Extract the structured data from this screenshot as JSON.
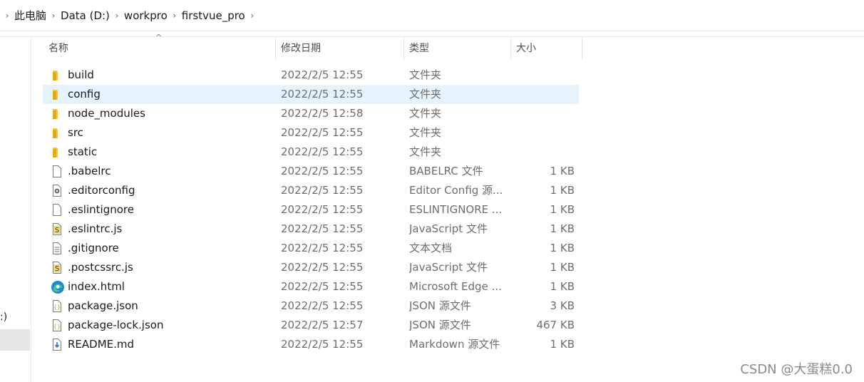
{
  "breadcrumb": {
    "items": [
      "此电脑",
      "Data (D:)",
      "workpro",
      "firstvue_pro"
    ],
    "separator": "›"
  },
  "nav": {
    "fragment": ":)"
  },
  "columns": {
    "name": "名称",
    "date": "修改日期",
    "type": "类型",
    "size": "大小",
    "sort_indicator": "^"
  },
  "rows": [
    {
      "name": "build",
      "date": "2022/2/5 12:55",
      "type": "文件夹",
      "size": "",
      "icon": "folder-icon"
    },
    {
      "name": "config",
      "date": "2022/2/5 12:55",
      "type": "文件夹",
      "size": "",
      "icon": "folder-icon",
      "selected": true
    },
    {
      "name": "node_modules",
      "date": "2022/2/5 12:58",
      "type": "文件夹",
      "size": "",
      "icon": "folder-icon"
    },
    {
      "name": "src",
      "date": "2022/2/5 12:55",
      "type": "文件夹",
      "size": "",
      "icon": "folder-icon"
    },
    {
      "name": "static",
      "date": "2022/2/5 12:55",
      "type": "文件夹",
      "size": "",
      "icon": "folder-icon"
    },
    {
      "name": ".babelrc",
      "date": "2022/2/5 12:55",
      "type": "BABELRC 文件",
      "size": "1 KB",
      "icon": "blank-file-icon"
    },
    {
      "name": ".editorconfig",
      "date": "2022/2/5 12:55",
      "type": "Editor Config 源...",
      "size": "1 KB",
      "icon": "config-file-icon"
    },
    {
      "name": ".eslintignore",
      "date": "2022/2/5 12:55",
      "type": "ESLINTIGNORE ...",
      "size": "1 KB",
      "icon": "blank-file-icon"
    },
    {
      "name": ".eslintrc.js",
      "date": "2022/2/5 12:55",
      "type": "JavaScript 文件",
      "size": "1 KB",
      "icon": "script-file-icon"
    },
    {
      "name": ".gitignore",
      "date": "2022/2/5 12:55",
      "type": "文本文档",
      "size": "1 KB",
      "icon": "text-file-icon"
    },
    {
      "name": ".postcssrc.js",
      "date": "2022/2/5 12:55",
      "type": "JavaScript 文件",
      "size": "1 KB",
      "icon": "script-file-icon"
    },
    {
      "name": "index.html",
      "date": "2022/2/5 12:55",
      "type": "Microsoft Edge ...",
      "size": "1 KB",
      "icon": "edge-icon"
    },
    {
      "name": "package.json",
      "date": "2022/2/5 12:55",
      "type": "JSON 源文件",
      "size": "3 KB",
      "icon": "json-file-icon"
    },
    {
      "name": "package-lock.json",
      "date": "2022/2/5 12:57",
      "type": "JSON 源文件",
      "size": "467 KB",
      "icon": "json-file-icon"
    },
    {
      "name": "README.md",
      "date": "2022/2/5 12:55",
      "type": "Markdown 源文件",
      "size": "1 KB",
      "icon": "markdown-file-icon"
    }
  ],
  "colors": {
    "selected_row": "#e5f3ff",
    "folder": "#f4c542"
  },
  "watermark": "CSDN @大蛋糕0.0"
}
